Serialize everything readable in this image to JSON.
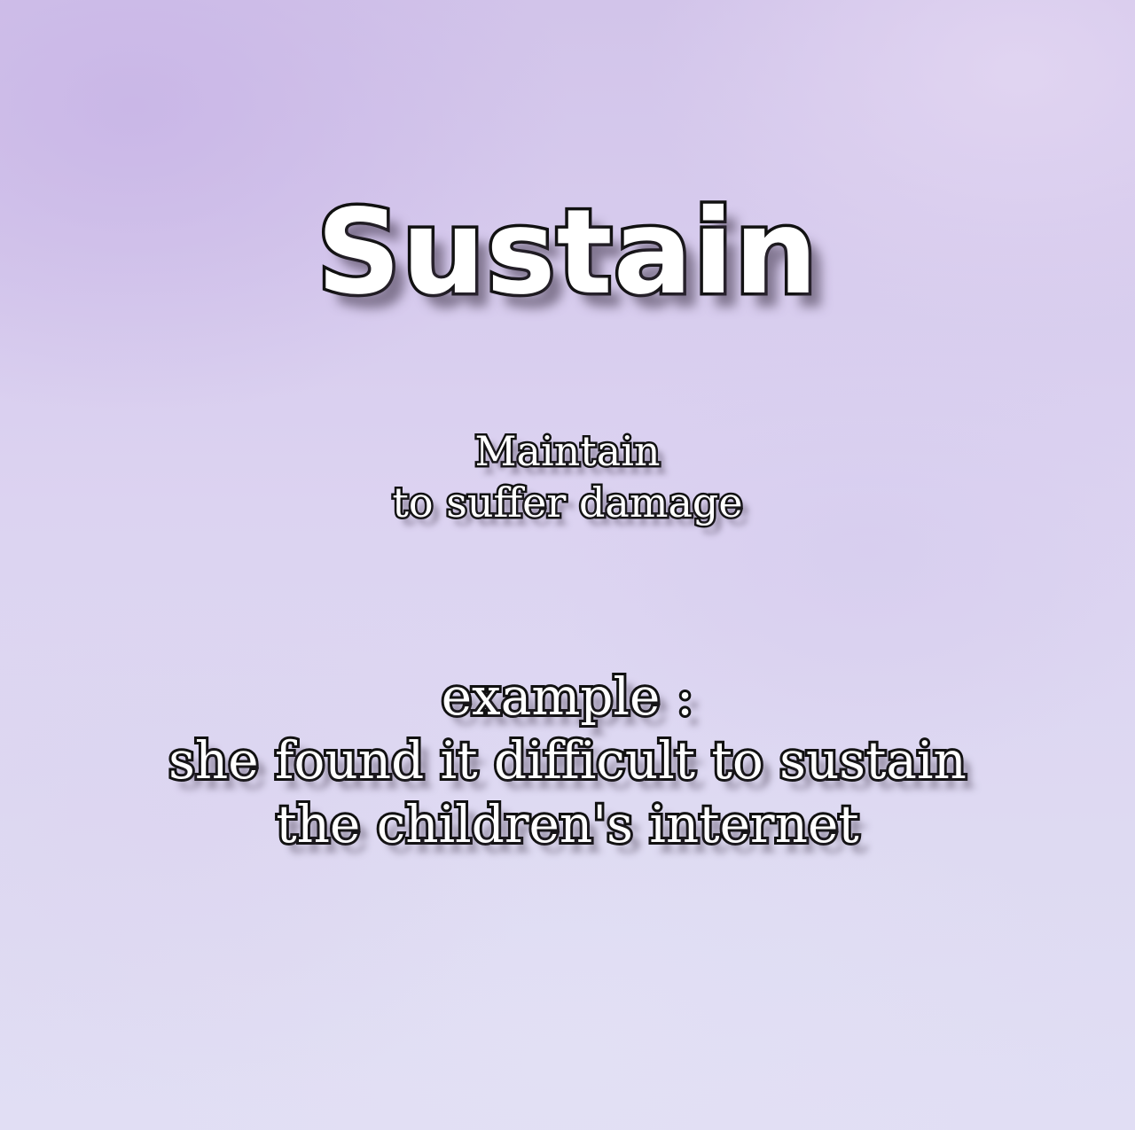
{
  "headword": "Sustain",
  "definitions": [
    "Maintain",
    "to suffer damage"
  ],
  "example": {
    "label": "example :",
    "lines": [
      "she found it difficult to sustain",
      "the children's internet"
    ]
  },
  "colors": {
    "background": "#dcd3f1",
    "text_fill": "#ffffff",
    "text_outline": "#111111"
  }
}
